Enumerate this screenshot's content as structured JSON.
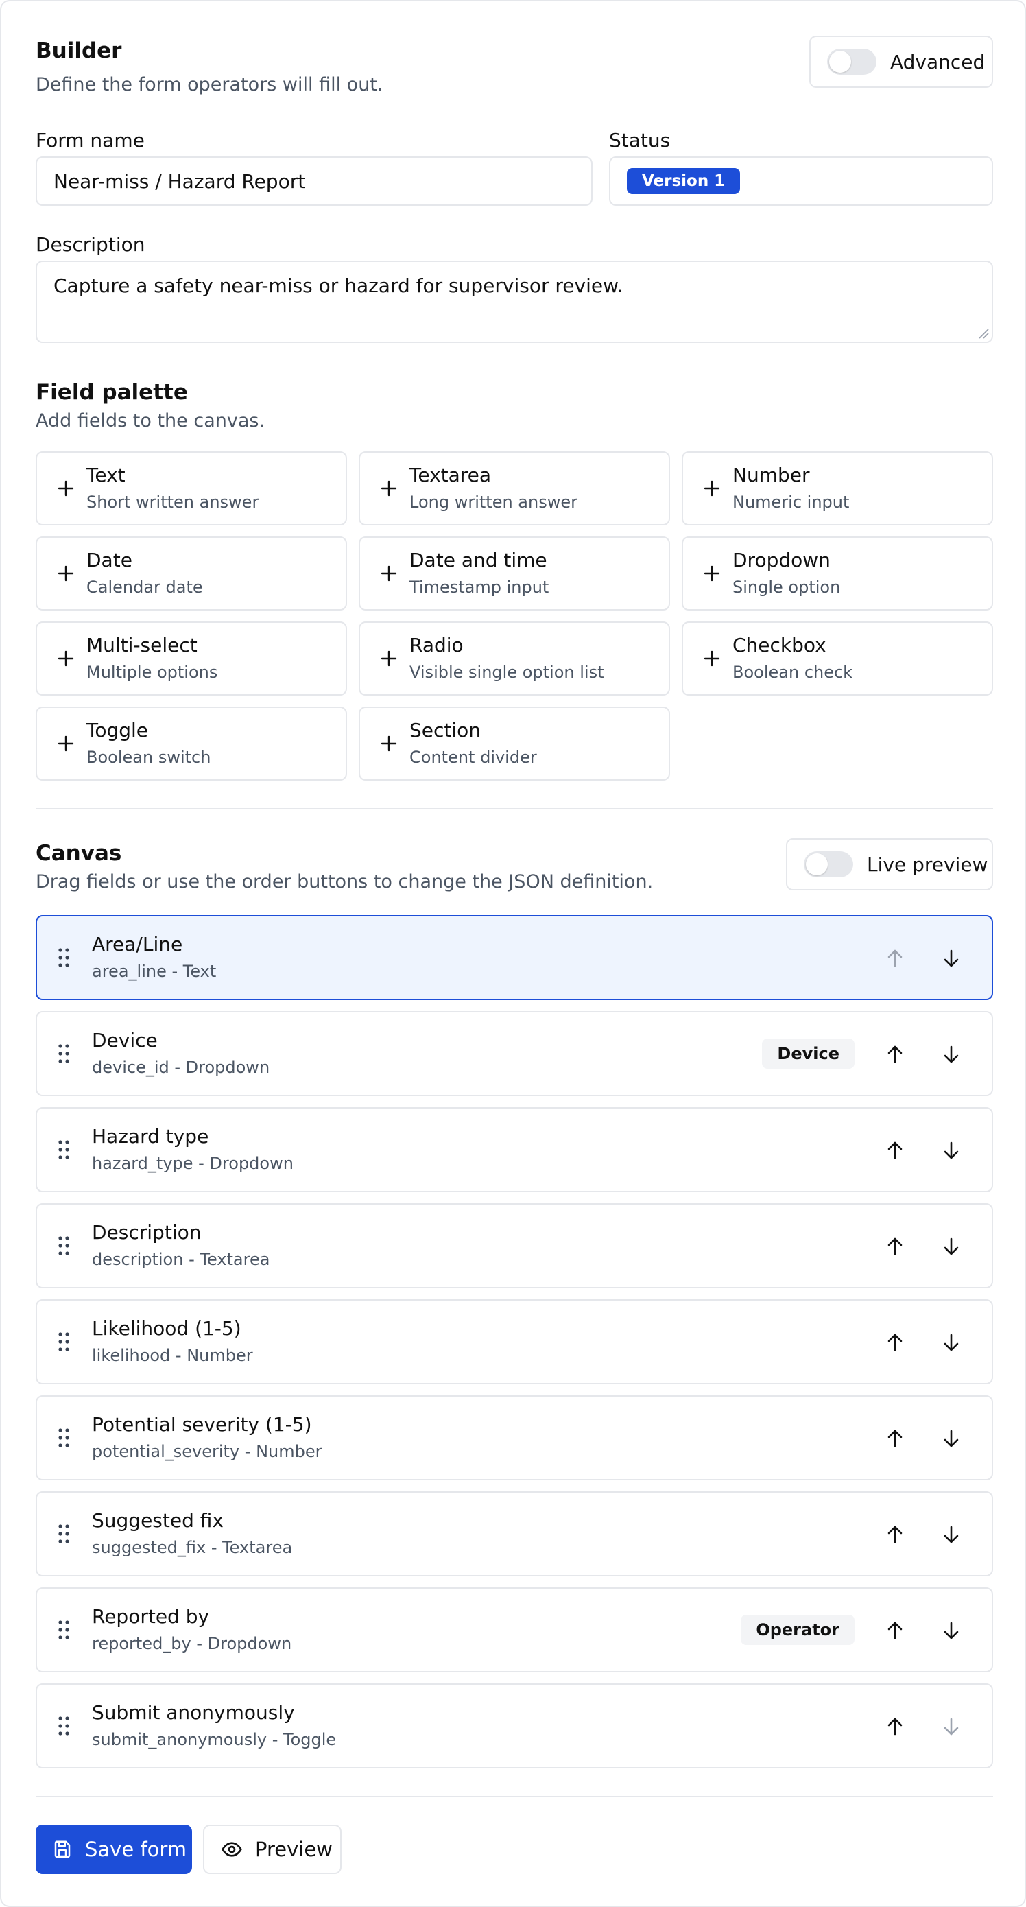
{
  "builder": {
    "title": "Builder",
    "subtitle": "Define the form operators will fill out.",
    "advanced_toggle": {
      "label": "Advanced",
      "on": false
    }
  },
  "form": {
    "name_label": "Form name",
    "name_value": "Near-miss / Hazard Report",
    "status_label": "Status",
    "status_badge": "Version 1",
    "description_label": "Description",
    "description_value": "Capture a safety near-miss or hazard for supervisor review."
  },
  "palette": {
    "title": "Field palette",
    "subtitle": "Add fields to the canvas.",
    "items": [
      {
        "title": "Text",
        "sub": "Short written answer"
      },
      {
        "title": "Textarea",
        "sub": "Long written answer"
      },
      {
        "title": "Number",
        "sub": "Numeric input"
      },
      {
        "title": "Date",
        "sub": "Calendar date"
      },
      {
        "title": "Date and time",
        "sub": "Timestamp input"
      },
      {
        "title": "Dropdown",
        "sub": "Single option"
      },
      {
        "title": "Multi-select",
        "sub": "Multiple options"
      },
      {
        "title": "Radio",
        "sub": "Visible single option list"
      },
      {
        "title": "Checkbox",
        "sub": "Boolean check"
      },
      {
        "title": "Toggle",
        "sub": "Boolean switch"
      },
      {
        "title": "Section",
        "sub": "Content divider"
      }
    ]
  },
  "canvas": {
    "title": "Canvas",
    "subtitle": "Drag fields or use the order buttons to change the JSON definition.",
    "live_preview_toggle": {
      "label": "Live preview",
      "on": false
    },
    "fields": [
      {
        "label": "Area/Line",
        "meta": "area_line - Text",
        "tag": "",
        "selected": true,
        "up_disabled": true,
        "down_disabled": false
      },
      {
        "label": "Device",
        "meta": "device_id - Dropdown",
        "tag": "Device",
        "selected": false,
        "up_disabled": false,
        "down_disabled": false
      },
      {
        "label": "Hazard type",
        "meta": "hazard_type - Dropdown",
        "tag": "",
        "selected": false,
        "up_disabled": false,
        "down_disabled": false
      },
      {
        "label": "Description",
        "meta": "description - Textarea",
        "tag": "",
        "selected": false,
        "up_disabled": false,
        "down_disabled": false
      },
      {
        "label": "Likelihood (1-5)",
        "meta": "likelihood - Number",
        "tag": "",
        "selected": false,
        "up_disabled": false,
        "down_disabled": false
      },
      {
        "label": "Potential severity (1-5)",
        "meta": "potential_severity - Number",
        "tag": "",
        "selected": false,
        "up_disabled": false,
        "down_disabled": false
      },
      {
        "label": "Suggested fix",
        "meta": "suggested_fix - Textarea",
        "tag": "",
        "selected": false,
        "up_disabled": false,
        "down_disabled": false
      },
      {
        "label": "Reported by",
        "meta": "reported_by - Dropdown",
        "tag": "Operator",
        "selected": false,
        "up_disabled": false,
        "down_disabled": false
      },
      {
        "label": "Submit anonymously",
        "meta": "submit_anonymously - Toggle",
        "tag": "",
        "selected": false,
        "up_disabled": false,
        "down_disabled": true
      }
    ]
  },
  "actions": {
    "save_label": "Save form",
    "save_icon": "save-icon",
    "preview_label": "Preview",
    "preview_icon": "eye-icon"
  },
  "colors": {
    "accent": "#1d4ed8",
    "selected_row_bg": "#eef4fe",
    "border": "#e5e7eb"
  }
}
